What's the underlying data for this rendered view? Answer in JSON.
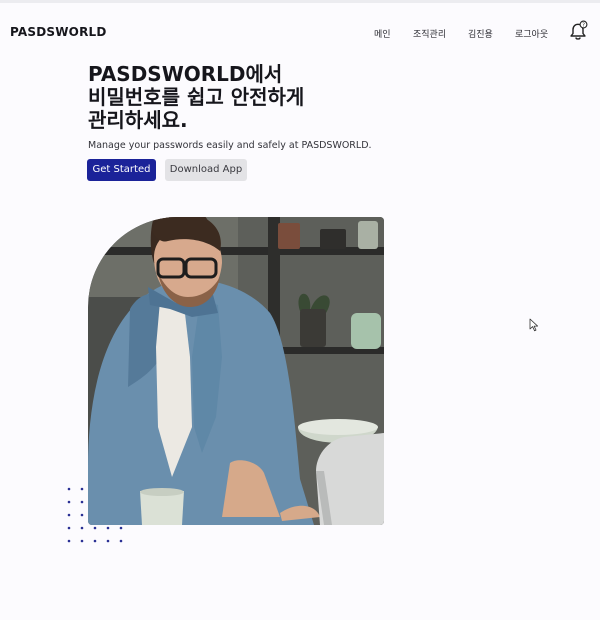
{
  "header": {
    "brand": "PASDSWORLD",
    "nav": [
      "메인",
      "조직관리",
      "김진용",
      "로그아웃"
    ],
    "notification_icon": "bell-icon"
  },
  "hero": {
    "title_lines": [
      "PASDSWORLD에서",
      "비밀번호를 쉽고 안전하게",
      "관리하세요."
    ],
    "subtitle": "Manage your passwords easily and safely at PASDSWORLD.",
    "primary_button": "Get Started",
    "secondary_button": "Download App",
    "accent_color": "#1b2399"
  }
}
